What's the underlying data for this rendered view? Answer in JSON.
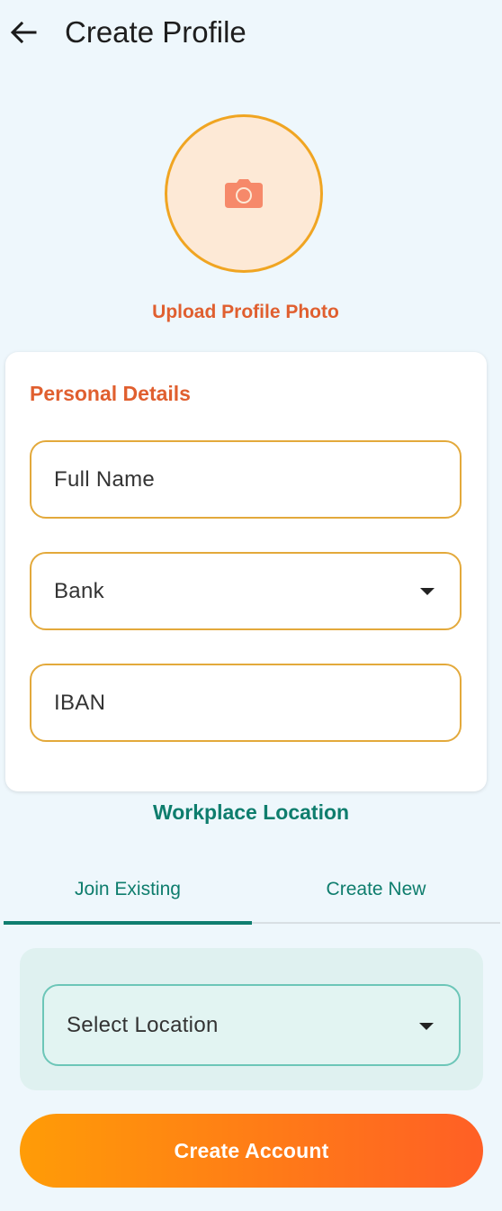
{
  "header": {
    "title": "Create Profile",
    "back_icon": "arrow-left-icon"
  },
  "avatar": {
    "icon": "camera-icon",
    "upload_label": "Upload Profile Photo"
  },
  "personal_details": {
    "title": "Personal Details",
    "full_name_placeholder": "Full Name",
    "bank_placeholder": "Bank",
    "iban_placeholder": "IBAN"
  },
  "workplace": {
    "title": "Workplace Location",
    "tabs": [
      {
        "label": "Join Existing",
        "active": true
      },
      {
        "label": "Create New",
        "active": false
      }
    ],
    "location_placeholder": "Select Location"
  },
  "actions": {
    "create_account_label": "Create Account"
  },
  "colors": {
    "primary_orange": "#e05f2f",
    "teal": "#0e7d6d",
    "field_border": "#e3a93b",
    "gradient_start": "#ff9c07",
    "gradient_end": "#ff5f25",
    "background": "#eef7fc"
  }
}
